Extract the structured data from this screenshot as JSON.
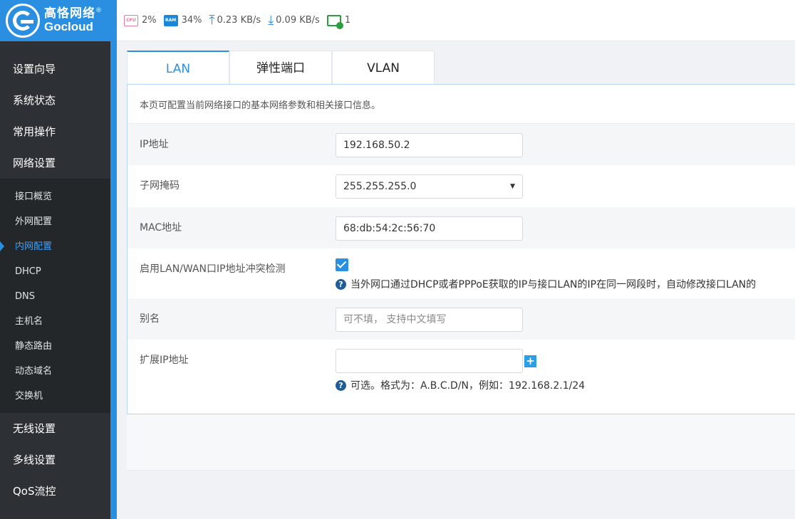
{
  "logo": {
    "cn": "高恪网络",
    "en": "Gocloud",
    "reg": "®"
  },
  "status": {
    "cpu_chip": "CPU",
    "cpu": "2%",
    "ram_chip": "RAM",
    "ram": "34%",
    "upload": "0.23 KB/s",
    "download": "0.09 KB/s",
    "connections": "1"
  },
  "sidebar": {
    "items_top": [
      "设置向导",
      "系统状态",
      "常用操作",
      "网络设置"
    ],
    "submenu": [
      "接口概览",
      "外网配置",
      "内网配置",
      "DHCP",
      "DNS",
      "主机名",
      "静态路由",
      "动态域名",
      "交换机"
    ],
    "active_submenu": "内网配置",
    "items_bottom": [
      "无线设置",
      "多线设置",
      "QoS流控"
    ]
  },
  "tabs": [
    "LAN",
    "弹性端口",
    "VLAN"
  ],
  "active_tab": "LAN",
  "panel": {
    "description": "本页可配置当前网络接口的基本网络参数和相关接口信息。",
    "ip_label": "IP地址",
    "ip_value": "192.168.50.2",
    "mask_label": "子网掩码",
    "mask_value": "255.255.255.0",
    "mac_label": "MAC地址",
    "mac_value": "68:db:54:2c:56:70",
    "conflict_label": "启用LAN/WAN口IP地址冲突检测",
    "conflict_checked": true,
    "conflict_hint": "当外网口通过DHCP或者PPPoE获取的IP与接口LAN的IP在同一网段时，自动修改接口LAN的",
    "alias_label": "别名",
    "alias_placeholder": "可不填， 支持中文填写",
    "ext_ip_label": "扩展IP地址",
    "ext_ip_value": "",
    "ext_ip_hint": "可选。格式为：A.B.C.D/N，例如：192.168.2.1/24"
  },
  "colors": {
    "accent": "#2a8fe1",
    "sidebar": "#2d3135",
    "checkbox": "#2a8fe1"
  }
}
